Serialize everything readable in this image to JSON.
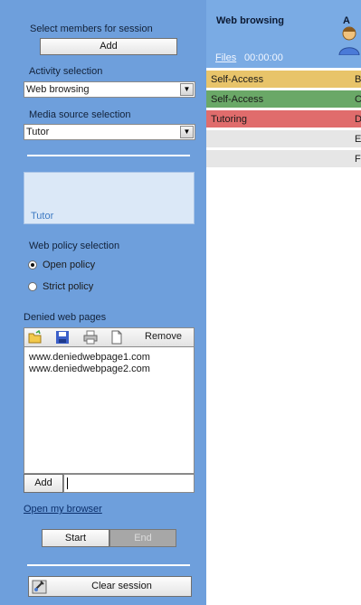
{
  "session": {
    "select_members_label": "Select members for session",
    "add_label": "Add"
  },
  "activity": {
    "label": "Activity selection",
    "value": "Web browsing"
  },
  "media": {
    "label": "Media source selection",
    "value": "Tutor",
    "preview_caption": "Tutor"
  },
  "web_policy": {
    "label": "Web policy selection",
    "options": [
      {
        "label": "Open policy",
        "selected": true
      },
      {
        "label": "Strict policy",
        "selected": false
      }
    ]
  },
  "denied": {
    "label": "Denied web pages",
    "toolbar": {
      "icons": [
        "open-folder-icon",
        "save-icon",
        "print-icon",
        "new-document-icon"
      ],
      "remove_label": "Remove"
    },
    "pages": [
      "www.deniedwebpage1.com",
      "www.deniedwebpage2.com"
    ],
    "add_label": "Add",
    "input_value": ""
  },
  "open_browser_label": "Open my browser",
  "controls": {
    "start_label": "Start",
    "end_label": "End"
  },
  "clear_label": "Clear session",
  "panel": {
    "title": "Web browsing",
    "title_cut": "A",
    "files_label": "Files",
    "timer": "00:00:00",
    "avatar_icon": "user-avatar-icon",
    "rows": [
      {
        "label": "Self-Access",
        "tail": "B",
        "color": "#e8c46a"
      },
      {
        "label": "Self-Access",
        "tail": "C",
        "color": "#6aa867"
      },
      {
        "label": "Tutoring",
        "tail": "D",
        "color": "#e06c6c"
      },
      {
        "label": "",
        "tail": "E",
        "color": "#e6e6e6"
      },
      {
        "label": "",
        "tail": "F",
        "color": "#e6e6e6"
      }
    ]
  },
  "colors": {
    "sidebar": "#6e9fdc",
    "header": "#7aabe4",
    "preview": "#dbe8f7",
    "preview_text": "#3d79c2"
  }
}
